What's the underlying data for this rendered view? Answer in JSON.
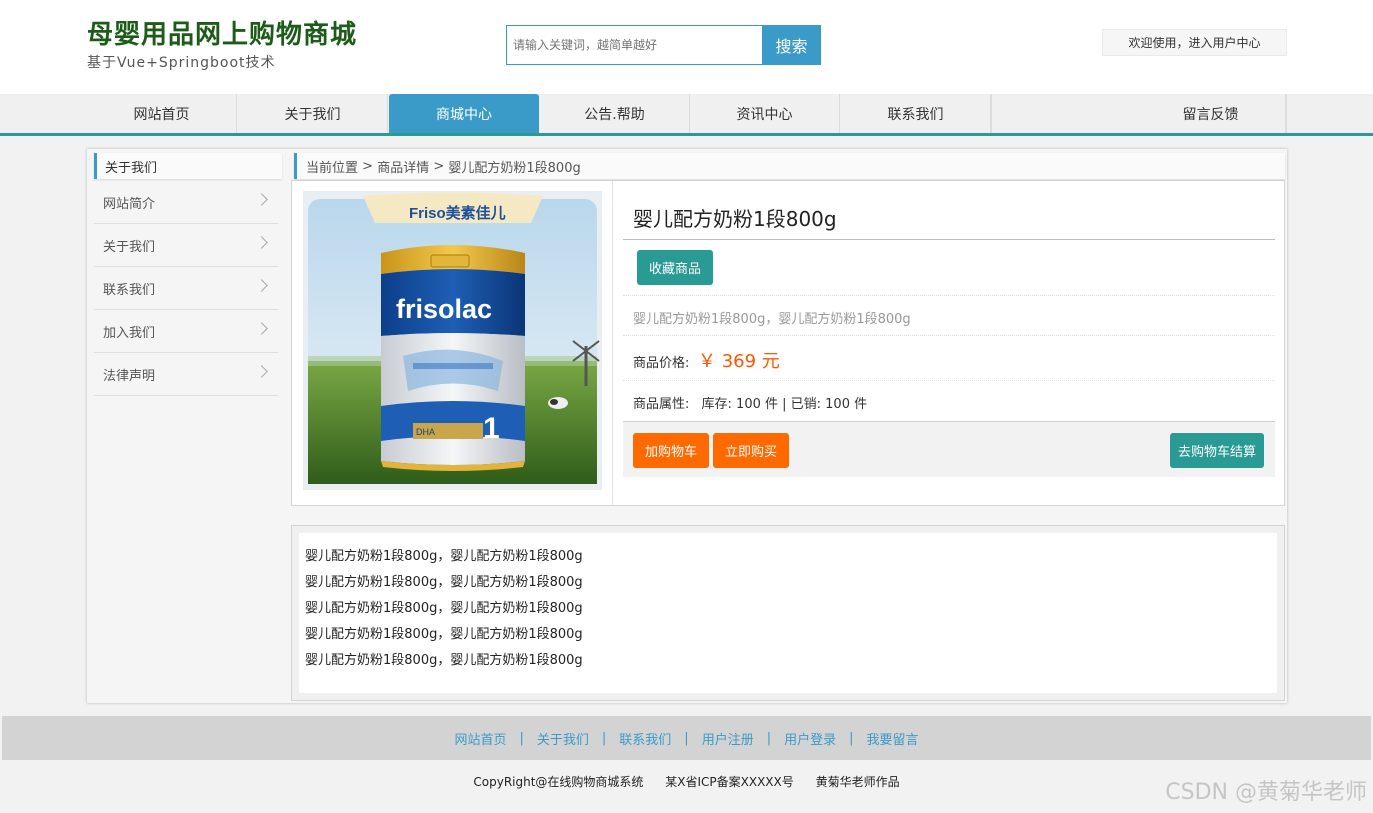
{
  "header": {
    "site_title": "母婴用品网上购物商城",
    "site_subtitle": "基于Vue+Springboot技术",
    "search_placeholder": "请输入关键词，越简单越好",
    "search_button": "搜索",
    "user_link": "欢迎使用，进入用户中心"
  },
  "nav": {
    "items": [
      {
        "label": "网站首页"
      },
      {
        "label": "关于我们"
      },
      {
        "label": "商城中心"
      },
      {
        "label": "公告.帮助"
      },
      {
        "label": "资讯中心"
      },
      {
        "label": "联系我们"
      },
      {
        "label": "留言反馈"
      }
    ],
    "active_index": 2
  },
  "sidebar": {
    "title": "关于我们",
    "items": [
      {
        "label": "网站简介"
      },
      {
        "label": "关于我们"
      },
      {
        "label": "联系我们"
      },
      {
        "label": "加入我们"
      },
      {
        "label": "法律声明"
      }
    ]
  },
  "breadcrumb": {
    "root": "当前位置",
    "separator": " > ",
    "level1": "商品详情",
    "level2": "婴儿配方奶粉1段800g"
  },
  "product": {
    "name": "婴儿配方奶粉1段800g",
    "favorite_button": "收藏商品",
    "short_desc": "婴儿配方奶粉1段800g，婴儿配方奶粉1段800g",
    "price_label": "商品价格:",
    "price": "￥ 369 元",
    "attr_label": "商品属性:",
    "attr_value": "库存: 100 件 | 已销: 100 件",
    "add_cart_button": "加购物车",
    "buy_now_button": "立即购买",
    "checkout_button": "去购物车结算",
    "image": {
      "brand_logo": "Friso美素佳儿",
      "can_label": "frisolac",
      "stage": "1",
      "dha": "DHA"
    }
  },
  "description": {
    "lines": [
      "婴儿配方奶粉1段800g，婴儿配方奶粉1段800g",
      "婴儿配方奶粉1段800g，婴儿配方奶粉1段800g",
      "婴儿配方奶粉1段800g，婴儿配方奶粉1段800g",
      "婴儿配方奶粉1段800g，婴儿配方奶粉1段800g",
      "婴儿配方奶粉1段800g，婴儿配方奶粉1段800g"
    ]
  },
  "footer": {
    "links": [
      {
        "label": "网站首页"
      },
      {
        "label": "关于我们"
      },
      {
        "label": "联系我们"
      },
      {
        "label": "用户注册"
      },
      {
        "label": "用户登录"
      },
      {
        "label": "我要留言"
      }
    ],
    "separator": "|",
    "copyright": "CopyRight@在线购物商城系统",
    "icp": "某X省ICP备案XXXXX号",
    "author": "黄菊华老师作品"
  },
  "watermark": "CSDN @黄菊华老师",
  "colors": {
    "brand_green": "#1d5c18",
    "accent_blue": "#3a9bc8",
    "accent_teal": "#2a9a95",
    "price_orange": "#ff5500",
    "button_orange": "#ff6a00"
  }
}
